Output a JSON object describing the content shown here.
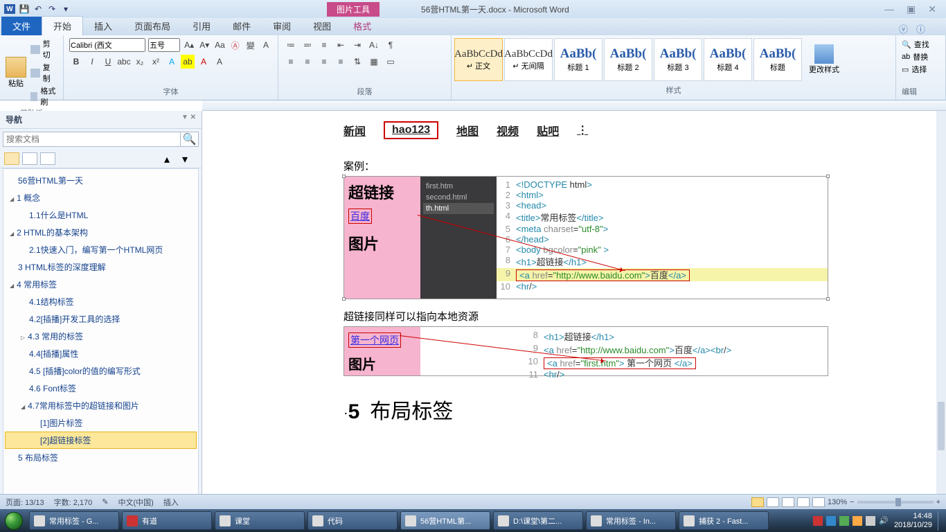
{
  "titlebar": {
    "picture_tools": "图片工具",
    "doc_title": "56营HTML第一天.docx - Microsoft Word"
  },
  "ribbon_tabs": {
    "file": "文件",
    "home": "开始",
    "insert": "插入",
    "layout": "页面布局",
    "references": "引用",
    "mail": "邮件",
    "review": "审阅",
    "view": "视图",
    "format": "格式"
  },
  "clipboard": {
    "paste": "粘贴",
    "cut": "剪切",
    "copy": "复制",
    "painter": "格式刷",
    "group": "剪贴板"
  },
  "font": {
    "family": "Calibri (西文",
    "size": "五号",
    "group": "字体"
  },
  "paragraph": {
    "group": "段落"
  },
  "styles": {
    "items": [
      {
        "prev": "AaBbCcDd",
        "name": "↵ 正文"
      },
      {
        "prev": "AaBbCcDd",
        "name": "↵ 无间隔"
      },
      {
        "prev": "AaBb(",
        "name": "标题 1"
      },
      {
        "prev": "AaBb(",
        "name": "标题 2"
      },
      {
        "prev": "AaBb(",
        "name": "标题 3"
      },
      {
        "prev": "AaBb(",
        "name": "标题 4"
      },
      {
        "prev": "AaBb(",
        "name": "标题"
      }
    ],
    "change": "更改样式",
    "group": "样式"
  },
  "editing": {
    "find": "查找",
    "replace": "替换",
    "select": "选择",
    "group": "编辑"
  },
  "nav": {
    "title": "导航",
    "search_ph": "搜索文档",
    "tree": [
      {
        "t": "56营HTML第一天",
        "lv": 0
      },
      {
        "t": "1 概念",
        "lv": 0,
        "e": 1
      },
      {
        "t": "1.1什么是HTML",
        "lv": 1
      },
      {
        "t": "2 HTML的基本架构",
        "lv": 0,
        "e": 1
      },
      {
        "t": "2.1快速入门，编写第一个HTML网页",
        "lv": 1
      },
      {
        "t": "3 HTML标签的深度理解",
        "lv": 0
      },
      {
        "t": "4 常用标签",
        "lv": 0,
        "e": 1
      },
      {
        "t": "4.1结构标签",
        "lv": 1
      },
      {
        "t": "4.2[插播]开发工具的选择",
        "lv": 1
      },
      {
        "t": "4.3 常用的标签",
        "lv": 1,
        "c": 1
      },
      {
        "t": "4.4[插播]属性",
        "lv": 1
      },
      {
        "t": "4.5 [插播]color的值的编写形式",
        "lv": 1
      },
      {
        "t": "4.6 Font标签",
        "lv": 1
      },
      {
        "t": "4.7常用标签中的超链接和图片",
        "lv": 1,
        "e": 1
      },
      {
        "t": "[1]图片标签",
        "lv": 2
      },
      {
        "t": "[2]超链接标签",
        "lv": 2,
        "sel": 1
      },
      {
        "t": "5 布局标签",
        "lv": 0
      }
    ]
  },
  "doc": {
    "nav_items": [
      "新闻",
      "hao123",
      "地图",
      "视频",
      "贴吧"
    ],
    "caption1": "案例：",
    "shot1": {
      "big1": "超链接",
      "link": "百度",
      "big2": "图片",
      "files": [
        "first.htm",
        "second.html",
        "th.html"
      ],
      "code": [
        {
          "n": 1,
          "h": "<!DOCTYPE html>"
        },
        {
          "n": 2,
          "h": "<html>"
        },
        {
          "n": 3,
          "h": "<head>"
        },
        {
          "n": 4,
          "h": "    <title>常用标签</title>"
        },
        {
          "n": 5,
          "h": "    <meta charset=\"utf-8\">"
        },
        {
          "n": 6,
          "h": "</head>"
        },
        {
          "n": 7,
          "h": "<body bgcolor=\"pink\" >"
        },
        {
          "n": 8,
          "h": "  <h1>超链接</h1>"
        },
        {
          "n": 9,
          "h": "  <a href=\"http://www.baidu.com\">百度</a>",
          "box": 1,
          "hl": 1
        },
        {
          "n": 10,
          "h": "  <hr/>"
        }
      ]
    },
    "caption2": "超链接同样可以指向本地资源",
    "shot2": {
      "link": "第一个网页",
      "big": "图片",
      "code": [
        {
          "n": 8,
          "h": "  <h1>超链接</h1>"
        },
        {
          "n": 9,
          "h": "  <a href=\"http://www.baidu.com\">百度</a><br/>"
        },
        {
          "n": 10,
          "h": "  <a href=\"first.htm\"> 第一个网页 </a>",
          "box": 1
        },
        {
          "n": 11,
          "h": "  <hr/>"
        }
      ]
    },
    "heading_num": "5",
    "heading_txt": "布局标签"
  },
  "status": {
    "page": "页面: 13/13",
    "words": "字数: 2,170",
    "lang": "中文(中国)",
    "mode": "插入",
    "zoom": "130%"
  },
  "taskbar": {
    "items": [
      {
        "label": "常用标签 - G..."
      },
      {
        "label": "有道",
        "red": 1
      },
      {
        "label": "课堂"
      },
      {
        "label": "代码"
      },
      {
        "label": "56营HTML第...",
        "active": 1
      },
      {
        "label": "D:\\课堂\\第二..."
      },
      {
        "label": "常用标签 - In..."
      },
      {
        "label": "捕获 2 - Fast..."
      }
    ],
    "time": "14:48",
    "date": "2018/10/29"
  }
}
